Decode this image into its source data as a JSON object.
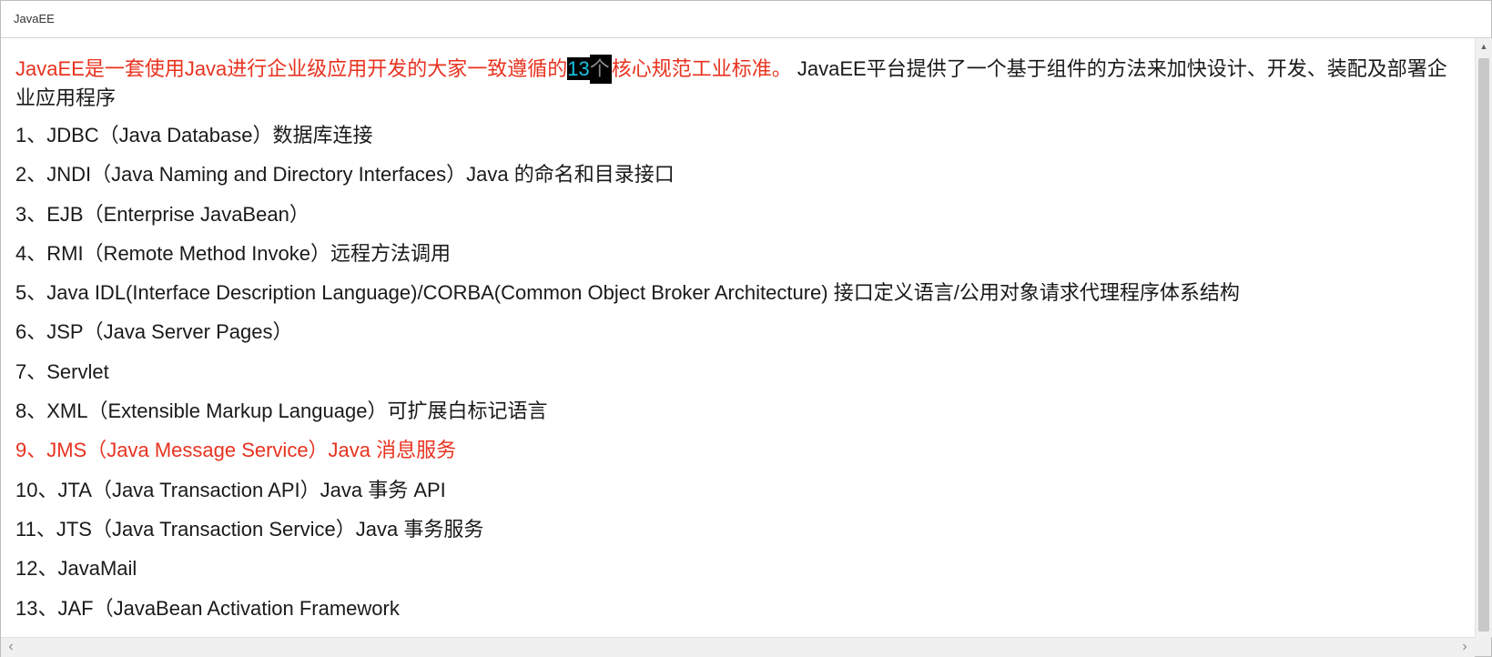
{
  "window": {
    "title": "JavaEE"
  },
  "intro": {
    "part1_red": "JavaEE是一套使用Java进行企业级应用开发的大家一致遵循的",
    "highlight_num": "13",
    "highlight_cut": "个",
    "part2_red": "核心规范工业标准。",
    "part3": " JavaEE平台提供了一个基于组件的方法来加快设计、开发、装配及部署企业应用程序"
  },
  "items": [
    {
      "text": "1、JDBC（Java Database）数据库连接"
    },
    {
      "text": "2、JNDI（Java Naming and Directory Interfaces）Java 的命名和目录接口"
    },
    {
      "text": "3、EJB（Enterprise JavaBean）"
    },
    {
      "text": "4、RMI（Remote Method Invoke）远程方法调用"
    },
    {
      "text": "5、Java IDL(Interface Description Language)/CORBA(Common Object Broker Architecture) 接口定义语言/公用对象请求代理程序体系结构"
    },
    {
      "text": "6、JSP（Java Server Pages）"
    },
    {
      "text": "7、Servlet"
    },
    {
      "text": "8、XML（Extensible Markup Language）可扩展白标记语言"
    },
    {
      "text": "9、JMS（Java Message Service）Java 消息服务"
    },
    {
      "text": "10、JTA（Java Transaction API）Java 事务 API"
    },
    {
      "text": "11、JTS（Java Transaction Service）Java 事务服务"
    },
    {
      "text": "12、JavaMail"
    },
    {
      "text": "13、JAF（JavaBean Activation Framework"
    }
  ],
  "colors": {
    "red": "#e8321f",
    "highlight_text": "#19c3e6",
    "highlight_bg": "#000000"
  },
  "icons": {
    "scroll_up": "caret-up-icon",
    "scroll_left": "chevron-left-icon",
    "scroll_right": "chevron-right-icon"
  }
}
